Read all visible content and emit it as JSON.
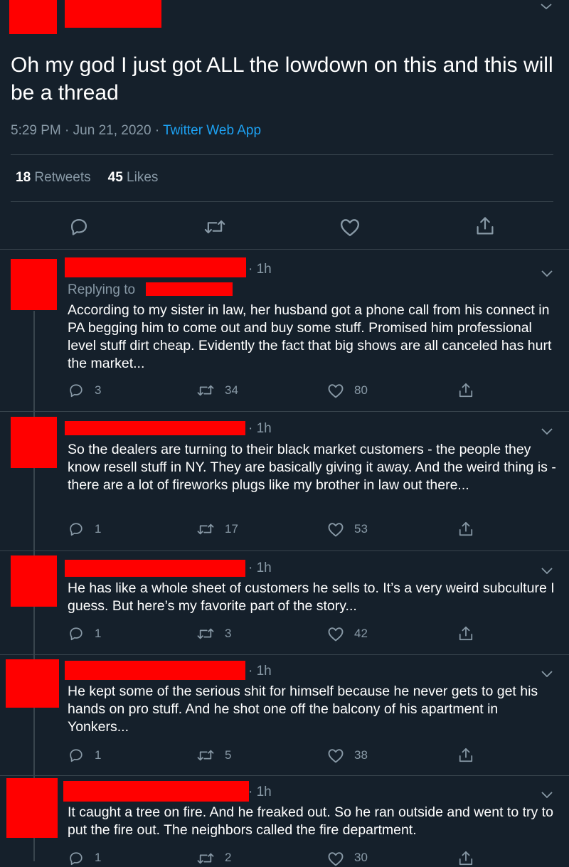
{
  "main_tweet": {
    "text": "Oh my god I just got ALL the lowdown on this and this will be a thread",
    "time": "5:29 PM",
    "sep1": "·",
    "date": "Jun 21, 2020",
    "sep2": "·",
    "app": "Twitter Web App",
    "retweets_count": "18",
    "retweets_label": "Retweets",
    "likes_count": "45",
    "likes_label": "Likes"
  },
  "colors": {
    "background": "#15202b",
    "text": "#ffffff",
    "muted": "#8899a6",
    "link": "#1da1f2",
    "divider": "#38444d",
    "redaction": "#ff0000"
  },
  "replies": [
    {
      "time": "· 1h",
      "replying_label": "Replying to",
      "text": "According to my sister in law, her husband got a phone call from his connect in PA begging him to come out and buy some stuff. Promised him professional level stuff dirt cheap. Evidently the fact that big shows are all canceled has hurt the market...",
      "replies": "3",
      "retweets": "34",
      "likes": "80"
    },
    {
      "time": "· 1h",
      "text": "So the dealers are turning to their black market customers - the people they know resell stuff in NY. They are basically giving it away. And the weird thing is - there are a lot of fireworks plugs like my brother in law out there...",
      "replies": "1",
      "retweets": "17",
      "likes": "53"
    },
    {
      "time": "· 1h",
      "text": "He has like a whole sheet of customers he sells to. It’s a very weird subculture I guess. But here’s my favorite part of the story...",
      "replies": "1",
      "retweets": "3",
      "likes": "42"
    },
    {
      "time": "· 1h",
      "text": "He kept some of the serious shit for himself because he never gets to get his hands on pro stuff. And he shot one off the balcony of his apartment in Yonkers...",
      "replies": "1",
      "retweets": "5",
      "likes": "38"
    },
    {
      "time": "· 1h",
      "text": "It caught a tree on fire. And he freaked out. So he ran outside and went to try to put the fire out. The neighbors called the fire department.",
      "replies": "1",
      "retweets": "2",
      "likes": "30"
    }
  ],
  "icons": {
    "reply": "reply-icon",
    "retweet": "retweet-icon",
    "like": "heart-icon",
    "share": "share-icon",
    "more": "chevron-down-icon"
  }
}
